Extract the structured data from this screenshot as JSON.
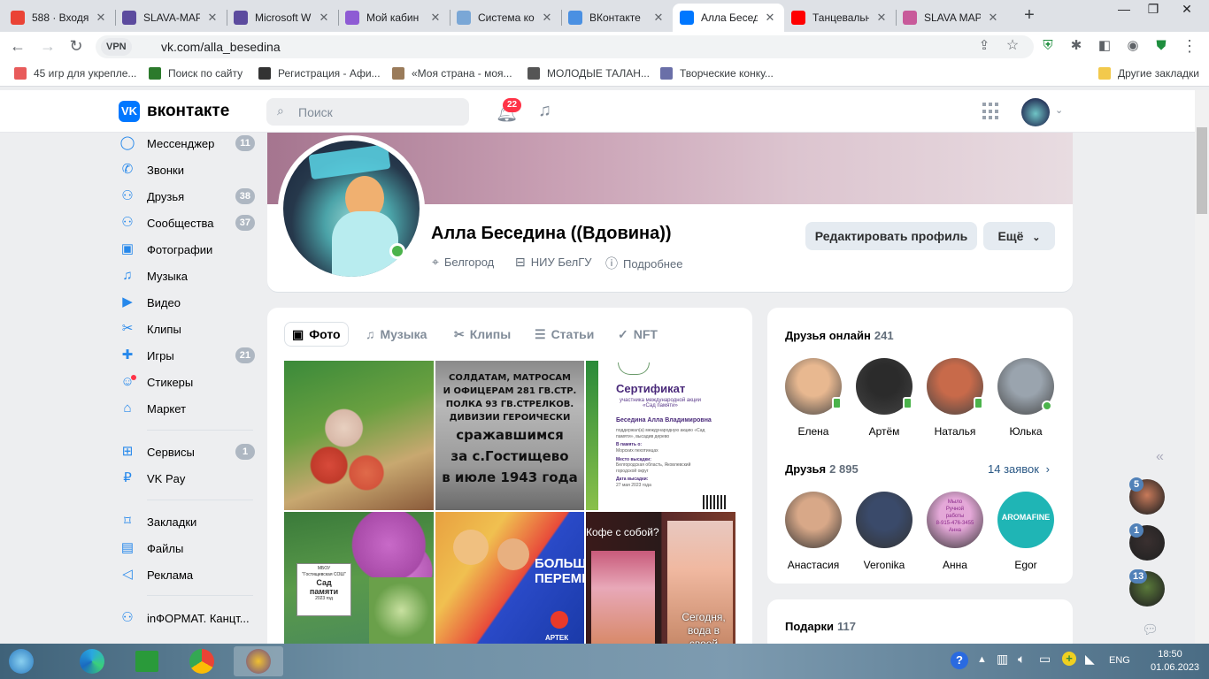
{
  "browser": {
    "tabs": [
      {
        "title": "588 · Входя",
        "icon_color": "#ea4335",
        "icon": "gmail-icon"
      },
      {
        "title": "SLAVA-МАР",
        "icon_color": "#5c4b9e",
        "icon": "globe-icon"
      },
      {
        "title": "Microsoft W",
        "icon_color": "#5c4b9e",
        "icon": "globe-icon"
      },
      {
        "title": "Мой кабин",
        "icon_color": "#8e5bd4",
        "icon": "cabinet-icon"
      },
      {
        "title": "Система ко",
        "icon_color": "#7aa7d6",
        "icon": "system-icon"
      },
      {
        "title": "ВКонтакте",
        "icon_color": "#4a90e2",
        "icon": "edge-icon"
      },
      {
        "title": "Алла Бесед",
        "icon_color": "#0077ff",
        "icon": "vk-icon",
        "active": true
      },
      {
        "title": "Танцевальн",
        "icon_color": "#ff0000",
        "icon": "youtube-icon"
      },
      {
        "title": "SLAVA МАР",
        "icon_color": "#c85a9a",
        "icon": "slava-icon"
      }
    ],
    "url": "vk.com/alla_besedina",
    "vpn_label": "VPN",
    "bookmarks": [
      {
        "label": "45 игр для укрепле...",
        "color": "#e85b5b"
      },
      {
        "label": "Поиск по сайту",
        "color": "#2c7a2c"
      },
      {
        "label": "Регистрация - Афи...",
        "color": "#333333"
      },
      {
        "label": "«Моя страна - моя...",
        "color": "#9a7b5a"
      },
      {
        "label": "МОЛОДЫЕ ТАЛАН...",
        "color": "#555555"
      },
      {
        "label": "Творческие конку...",
        "color": "#6a6fa8"
      }
    ],
    "other_bookmarks": "Другие закладки"
  },
  "vk": {
    "logo_text": "вконтакте",
    "search_placeholder": "Поиск",
    "notifications_count": "22"
  },
  "menu": [
    {
      "label": "Мессенджер",
      "icon": "messenger-icon",
      "glyph": "◯",
      "count": "11"
    },
    {
      "label": "Звонки",
      "icon": "phone-icon",
      "glyph": "✆",
      "count": ""
    },
    {
      "label": "Друзья",
      "icon": "friends-icon",
      "glyph": "⚇",
      "count": "38"
    },
    {
      "label": "Сообщества",
      "icon": "communities-icon",
      "glyph": "⚇",
      "count": "37"
    },
    {
      "label": "Фотографии",
      "icon": "photos-icon",
      "glyph": "▣",
      "count": ""
    },
    {
      "label": "Музыка",
      "icon": "music-icon",
      "glyph": "♫",
      "count": ""
    },
    {
      "label": "Видео",
      "icon": "video-icon",
      "glyph": "▶",
      "count": ""
    },
    {
      "label": "Клипы",
      "icon": "clips-icon",
      "glyph": "✂",
      "count": ""
    },
    {
      "label": "Игры",
      "icon": "games-icon",
      "glyph": "✚",
      "count": "21"
    },
    {
      "label": "Стикеры",
      "icon": "stickers-icon",
      "glyph": "☺",
      "count": ""
    },
    {
      "label": "Маркет",
      "icon": "market-icon",
      "glyph": "⌂",
      "count": ""
    },
    {
      "label": "Сервисы",
      "icon": "services-icon",
      "glyph": "⊞",
      "count": "1"
    },
    {
      "label": "VK Pay",
      "icon": "vkpay-icon",
      "glyph": "₽",
      "count": ""
    },
    {
      "label": "Закладки",
      "icon": "bookmarks-icon",
      "glyph": "⌑",
      "count": ""
    },
    {
      "label": "Файлы",
      "icon": "files-icon",
      "glyph": "▤",
      "count": ""
    },
    {
      "label": "Реклама",
      "icon": "ads-icon",
      "glyph": "◁",
      "count": ""
    },
    {
      "label": "inФОРМАТ. Канцт...",
      "icon": "community-icon",
      "glyph": "⚇",
      "count": ""
    }
  ],
  "profile": {
    "name": "Алла Беседина ((Вдовина))",
    "city": "Белгород",
    "university": "НИУ БелГУ",
    "more": "Подробнее",
    "edit_button": "Редактировать профиль",
    "more_button": "Ещё"
  },
  "media_tabs": [
    {
      "label": "Фото",
      "icon": "photo-tab-icon",
      "glyph": "▣"
    },
    {
      "label": "Музыка",
      "icon": "music-tab-icon",
      "glyph": "♫"
    },
    {
      "label": "Клипы",
      "icon": "clips-tab-icon",
      "glyph": "✂"
    },
    {
      "label": "Статьи",
      "icon": "articles-tab-icon",
      "glyph": "☰"
    },
    {
      "label": "NFT",
      "icon": "nft-tab-icon",
      "glyph": "✓"
    }
  ],
  "photos": {
    "memorial_text": [
      "СОЛДАТАМ, МАТРОСАМ",
      "И ОФИЦЕРАМ 281 ГВ.СТР.",
      "ПОЛКА 93 ГВ.СТРЕЛКОВ.",
      "ДИВИЗИИ ГЕРОИЧЕСКИ",
      "сражавшимся",
      "за с.Гостищево",
      "в июле 1943 года"
    ],
    "certificate": {
      "title": "Сертификат",
      "subtitle": "участника международной акции «Сад памяти»",
      "person": "Беседина Алла Владимировна",
      "line1": "поддержал(а) международную акцию «Сад памяти», высадив дерево",
      "memory_label": "В память о:",
      "memory_value": "Морских пехотинцах",
      "place_label": "Место высадки:",
      "place_value": "Белгородская область, Яковлевский городской округ",
      "date_label": "Дата высадки:",
      "date_value": "27 мая 2023 года"
    },
    "garden_sign": [
      "МБОУ",
      "\"Гостищевская СОШ\"",
      "Сад",
      "памяти",
      "2023 год"
    ],
    "banner_text": [
      "БОЛЬШ",
      "ПЕРЕМЕ"
    ],
    "artek": "АРТЕК",
    "coffee": "Кофе с собой?",
    "today": [
      "Сегодня,",
      "вода в своей"
    ]
  },
  "friends_online": {
    "title": "Друзья онлайн",
    "count": "241",
    "items": [
      {
        "name": "Елена",
        "status": "mobile",
        "color": "#e8b890"
      },
      {
        "name": "Артём",
        "status": "mobile",
        "color": "#2b2b2b"
      },
      {
        "name": "Наталья",
        "status": "mobile",
        "color": "#c86a4a"
      },
      {
        "name": "Юлька",
        "status": "online",
        "color": "#9aa4ae"
      }
    ]
  },
  "friends": {
    "title": "Друзья",
    "count": "2 895",
    "requests": "14 заявок",
    "items": [
      {
        "name": "Анастасия",
        "color": "#d8a888"
      },
      {
        "name": "Veronika",
        "color": "#3a4a6a"
      },
      {
        "name": "Анна",
        "color": "#e4a8d8"
      },
      {
        "name": "Egor",
        "color": "#1fb5b5",
        "label": "AROMAFINE"
      }
    ]
  },
  "anna_avatar_text": [
    "Мыло",
    "Ручной",
    "работы",
    "8-915-476-3455",
    "Анна"
  ],
  "gifts": {
    "title": "Подарки",
    "count": "117"
  },
  "chats": [
    {
      "badge": "5",
      "color": "#c87a5a"
    },
    {
      "badge": "1",
      "color": "#3a3030"
    },
    {
      "badge": "13",
      "color": "#5a7a3a"
    }
  ],
  "taskbar": {
    "lang": "ENG",
    "time": "18:50",
    "date": "01.06.2023"
  }
}
